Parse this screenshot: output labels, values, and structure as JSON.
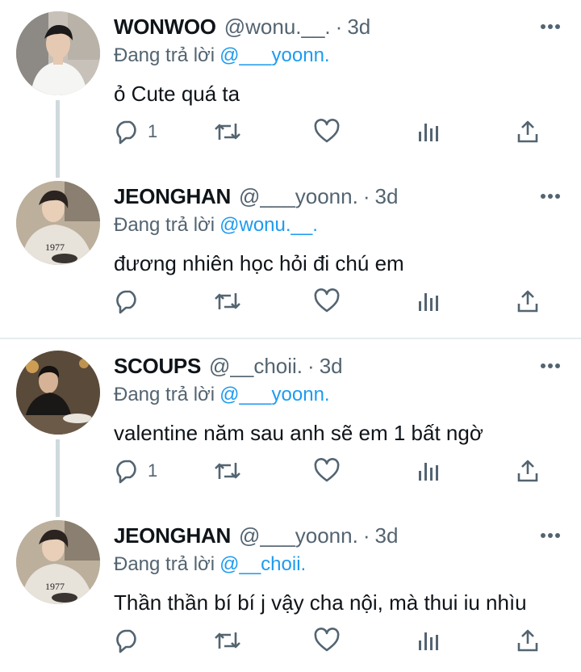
{
  "tweets": [
    {
      "name": "WONWOO",
      "handle": "@wonu.__.",
      "dot": "·",
      "time": "3d",
      "reply_prefix": "Đang trả lời",
      "reply_to": "@___yoonn.",
      "text": "ỏ Cute quá ta",
      "reply_count": "1"
    },
    {
      "name": "JEONGHAN",
      "handle": "@___yoonn.",
      "dot": "·",
      "time": "3d",
      "reply_prefix": "Đang trả lời",
      "reply_to": "@wonu.__.",
      "text": "đương nhiên học hỏi đi chú em",
      "reply_count": ""
    },
    {
      "name": "SCOUPS",
      "handle": "@__choii.",
      "dot": "·",
      "time": "3d",
      "reply_prefix": "Đang trả lời",
      "reply_to": "@___yoonn.",
      "text": "valentine năm sau anh sẽ em 1 bất ngờ",
      "reply_count": "1"
    },
    {
      "name": "JEONGHAN",
      "handle": "@___yoonn.",
      "dot": "·",
      "time": "3d",
      "reply_prefix": "Đang trả lời",
      "reply_to": "@__choii.",
      "text": "Thần thần bí bí j vậy cha nội, mà thui iu nhìu",
      "reply_count": ""
    }
  ],
  "icons": {
    "reply": "reply-icon",
    "retweet": "retweet-icon",
    "like": "heart-icon",
    "views": "analytics-icon",
    "share": "share-icon",
    "more": "more-icon"
  },
  "colors": {
    "text": "#0f1419",
    "secondary": "#536471",
    "link": "#1d9bf0",
    "thread_line": "#cfd9de",
    "divider": "#e6ecf0"
  }
}
